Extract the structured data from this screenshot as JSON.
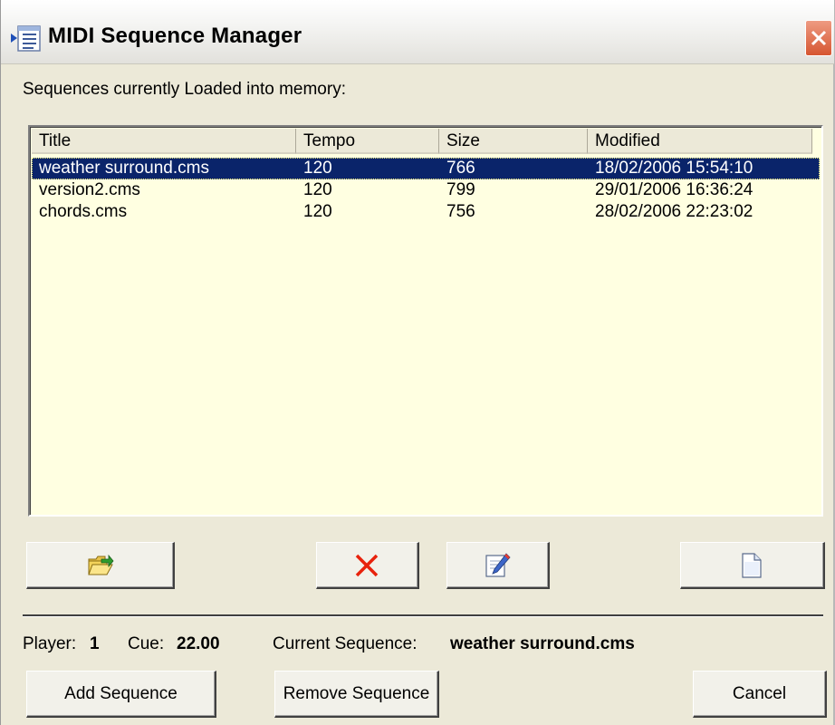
{
  "window": {
    "title": "MIDI Sequence Manager"
  },
  "list_label": "Sequences currently Loaded into memory:",
  "table": {
    "columns": [
      "Title",
      "Tempo",
      "Size",
      "Modified"
    ],
    "rows": [
      {
        "title": "weather surround.cms",
        "tempo": "120",
        "size": "766",
        "modified": "18/02/2006 15:54:10",
        "selected": true
      },
      {
        "title": "version2.cms",
        "tempo": "120",
        "size": "799",
        "modified": "29/01/2006 16:36:24",
        "selected": false
      },
      {
        "title": "chords.cms",
        "tempo": "120",
        "size": "756",
        "modified": "28/02/2006 22:23:02",
        "selected": false
      }
    ]
  },
  "icon_buttons": {
    "open": "open-folder-icon",
    "delete": "delete-x-icon",
    "edit": "edit-pencil-icon",
    "new": "new-document-icon"
  },
  "status": {
    "player_label": "Player:",
    "player_value": "1",
    "cue_label": "Cue:",
    "cue_value": "22.00",
    "current_label": "Current Sequence:",
    "current_value": "weather surround.cms"
  },
  "buttons": {
    "add": "Add Sequence",
    "remove": "Remove Sequence",
    "cancel": "Cancel"
  },
  "colors": {
    "selection": "#0a246a",
    "list_background": "#ffffe1",
    "delete_icon": "#e8220c"
  }
}
